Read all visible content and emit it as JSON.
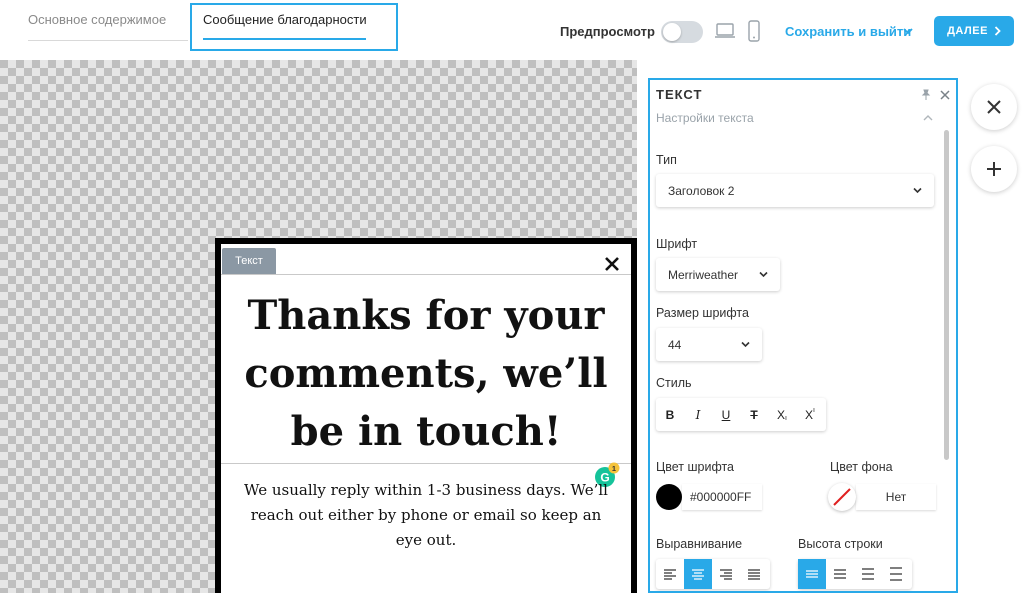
{
  "topbar": {
    "tab_main": "Основное содержимое",
    "tab_thanks": "Сообщение благодарности",
    "preview_label": "Предпросмотр",
    "save_exit": "Сохранить и выйти",
    "next_label": "ДАЛЕЕ"
  },
  "modal": {
    "tag": "Текст",
    "headline": "Thanks for your comments, we’ll be in touch!",
    "body": "We usually reply within 1-3 business days. We’ll reach out either by phone or email so keep an eye out.",
    "grammarly_badge": "1"
  },
  "panel": {
    "title": "ТЕКСТ",
    "subtitle": "Настройки текста",
    "type_label": "Тип",
    "type_value": "Заголовок 2",
    "font_label": "Шрифт",
    "font_value": "Merriweather",
    "size_label": "Размер шрифта",
    "size_value": "44",
    "style_label": "Стиль",
    "style_buttons": [
      "B",
      "I",
      "U",
      "T",
      "X",
      "X"
    ],
    "font_color_label": "Цвет шрифта",
    "font_color_value": "#000000FF",
    "bg_color_label": "Цвет фона",
    "bg_color_value": "Нет",
    "align_label": "Выравнивание",
    "line_height_label": "Высота строки"
  },
  "colors": {
    "accent": "#29a9e8",
    "tag": "#8b98a4",
    "font_color": "#000000"
  }
}
